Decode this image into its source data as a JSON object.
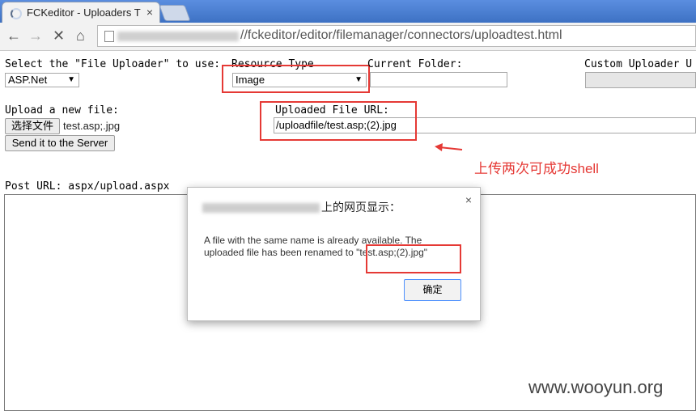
{
  "browser": {
    "tab_title": "FCKeditor - Uploaders T",
    "tab_close": "×",
    "url_visible": "//fckeditor/editor/filemanager/connectors/uploadtest.html",
    "nav": {
      "back": "←",
      "forward": "→",
      "stop": "✕",
      "home": "⌂"
    }
  },
  "form": {
    "select_uploader_label": "Select the \"File Uploader\" to use:",
    "uploader_value": "ASP.Net",
    "resource_type_label": "Resource Type",
    "resource_type_value": "Image",
    "current_folder_label": "Current Folder:",
    "current_folder_value": "",
    "custom_uploader_label": "Custom Uploader U",
    "upload_new_label": "Upload a new file:",
    "choose_file_button": "选择文件",
    "chosen_file": "test.asp;.jpg",
    "send_button": "Send it to the Server",
    "uploaded_url_label": "Uploaded File URL:",
    "uploaded_url_value": "/uploadfile/test.asp;(2).jpg",
    "post_url_text": "Post URL: aspx/upload.aspx"
  },
  "annotation": {
    "text": "上传两次可成功shell",
    "color": "#e53935"
  },
  "dialog": {
    "title_suffix": "上的网页显示：",
    "close": "×",
    "message_line1": "A file with the same name is already available. The",
    "message_line2": "uploaded file has been renamed to ",
    "renamed_file": "\"test.asp;(2).jpg\"",
    "ok_button": "确定"
  },
  "watermark": "www.wooyun.org",
  "icons": {
    "dropdown": "▼"
  }
}
